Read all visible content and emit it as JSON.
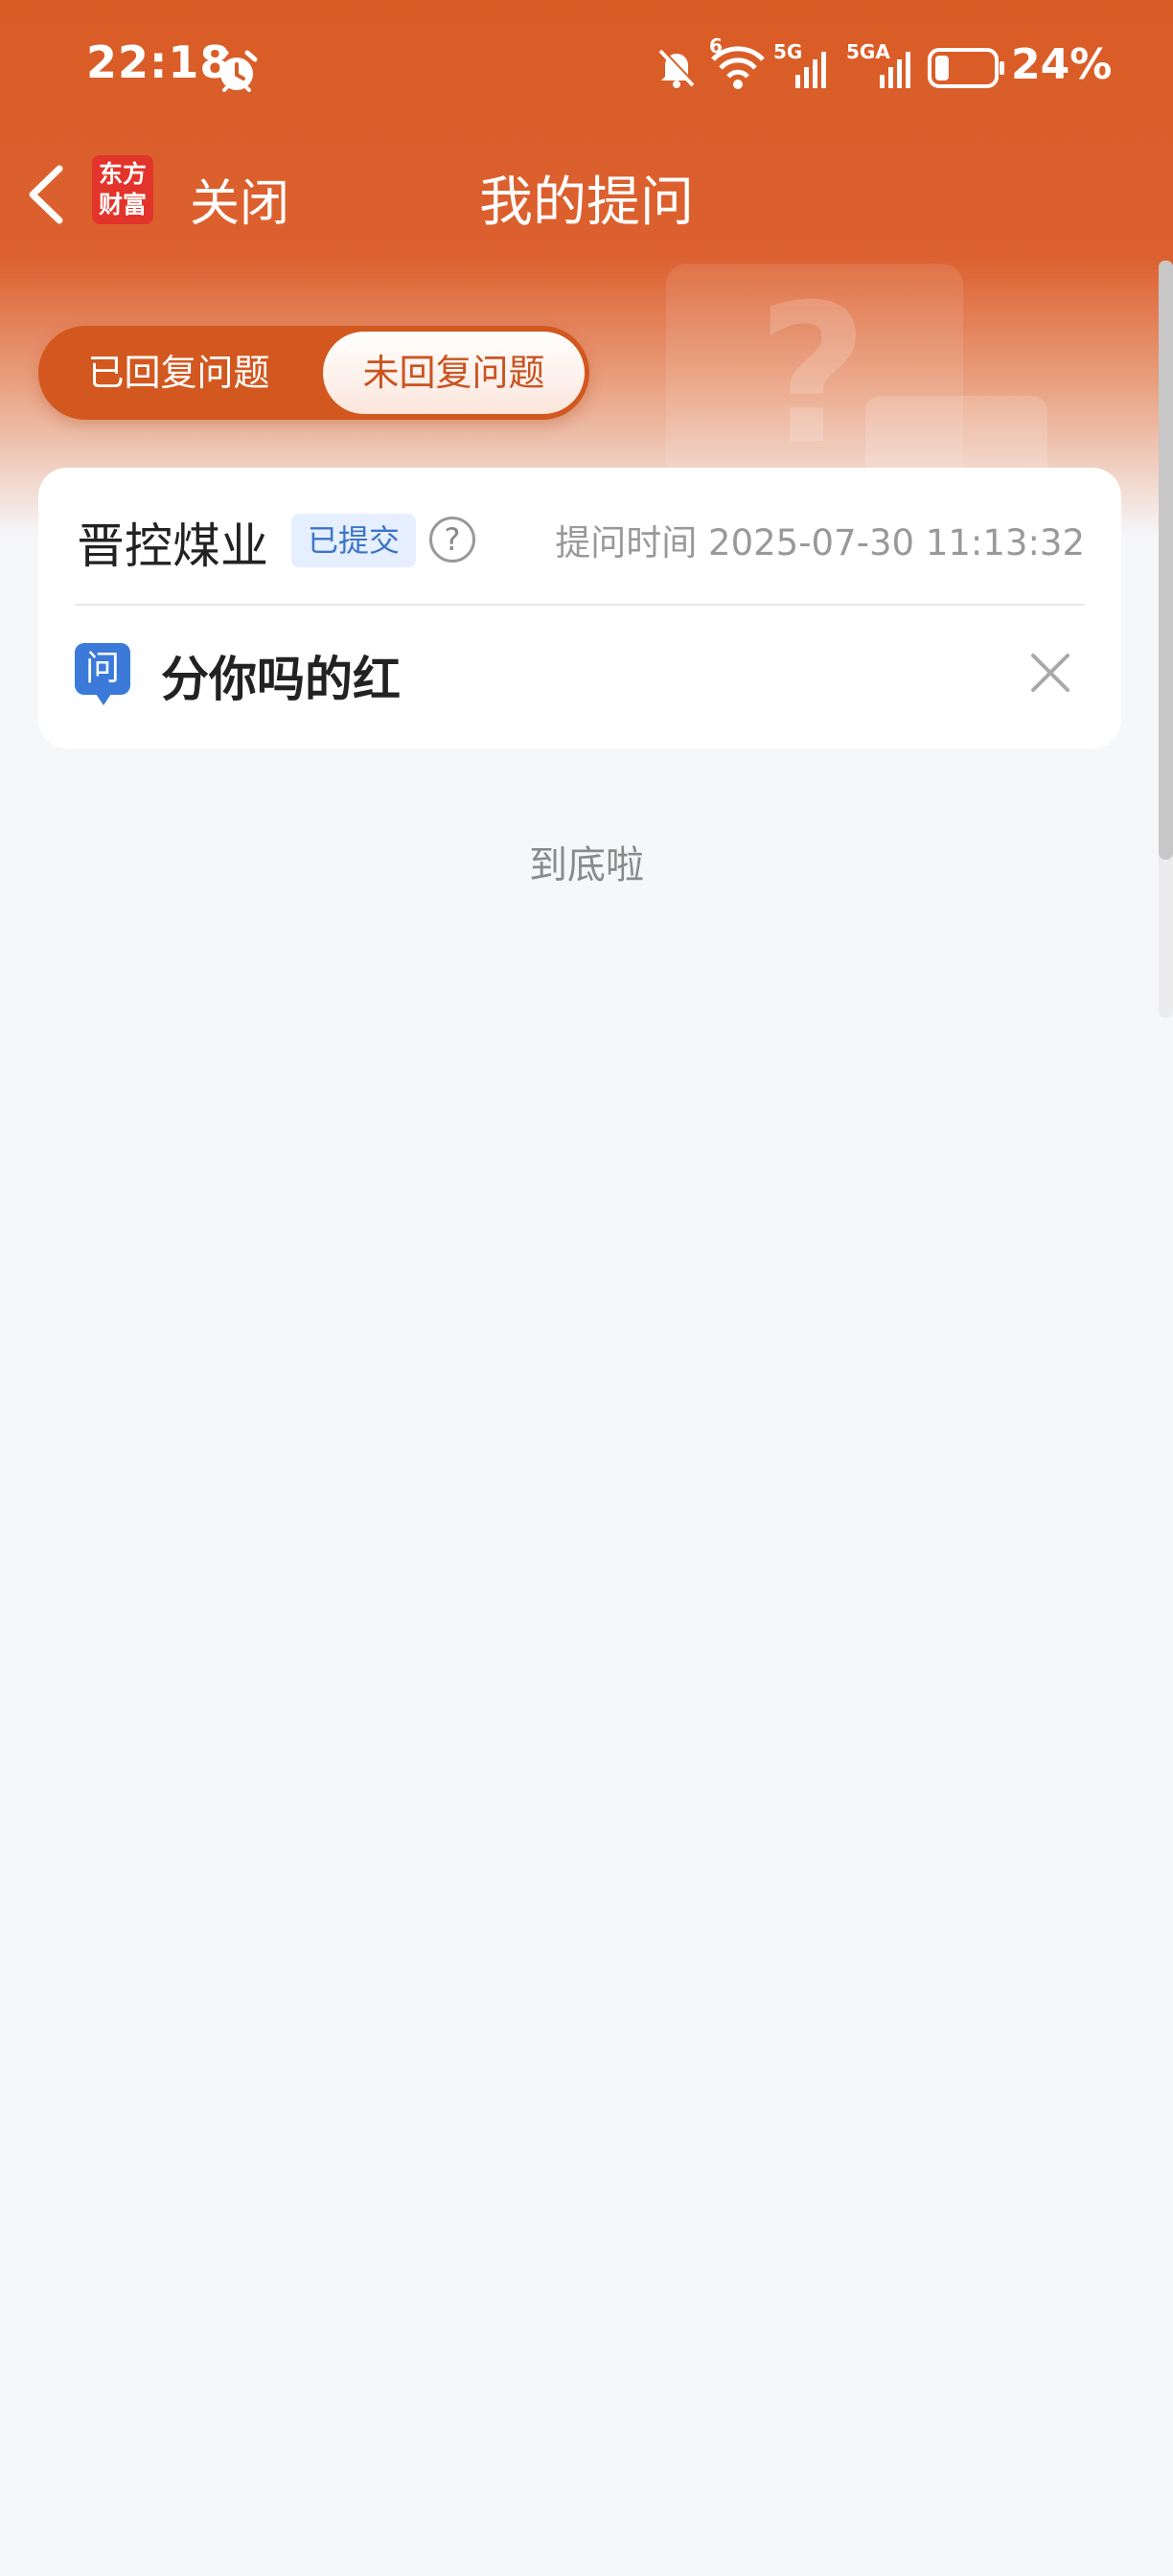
{
  "status_bar": {
    "time": "22:18",
    "battery_percent": "24%",
    "battery_level": 0.24,
    "icons": [
      "alarm-icon",
      "bell-off-icon",
      "wifi-icon",
      "signal-5g-icon",
      "signal-5ga-icon",
      "battery-icon"
    ],
    "sim1_label": "5G",
    "sim2_label": "5GA",
    "wifi_label": "6"
  },
  "nav": {
    "logo_line1": "东方",
    "logo_line2": "财富",
    "close_label": "关闭",
    "title": "我的提问"
  },
  "tabs": [
    {
      "label": "已回复问题",
      "active": false
    },
    {
      "label": "未回复问题",
      "active": true
    }
  ],
  "questions": [
    {
      "stock_name": "晋控煤业",
      "status": "已提交",
      "help_symbol": "?",
      "time": "提问时间 2025-07-30 11:13:32",
      "q_badge": "问",
      "text": "分你吗的红"
    }
  ],
  "end_text": "到底啦",
  "colors": {
    "brand_orange": "#d95c25",
    "badge_blue": "#3b7ad9",
    "status_badge_bg": "#e5efff",
    "status_badge_text": "#3c74c9"
  }
}
